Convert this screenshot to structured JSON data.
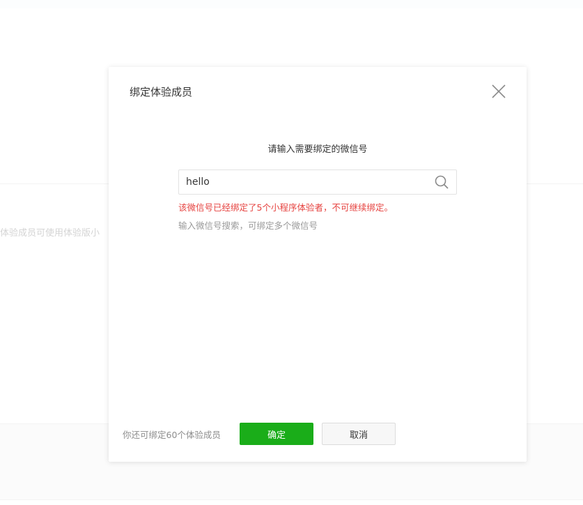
{
  "background": {
    "description_text": "体验成员可使用体验版小"
  },
  "dialog": {
    "title": "绑定体验成员",
    "prompt": "请输入需要绑定的微信号",
    "search": {
      "value": "hello",
      "placeholder": ""
    },
    "error_text": "该微信号已经绑定了5个小程序体验者，不可继续绑定。",
    "hint_text": "输入微信号搜索，可绑定多个微信号",
    "footer_info": "你还可绑定60个体验成员",
    "confirm_label": "确定",
    "cancel_label": "取消",
    "icons": {
      "close": "close-icon",
      "search": "search-icon"
    },
    "colors": {
      "confirm": "#1aad19",
      "error": "#e64340"
    }
  }
}
